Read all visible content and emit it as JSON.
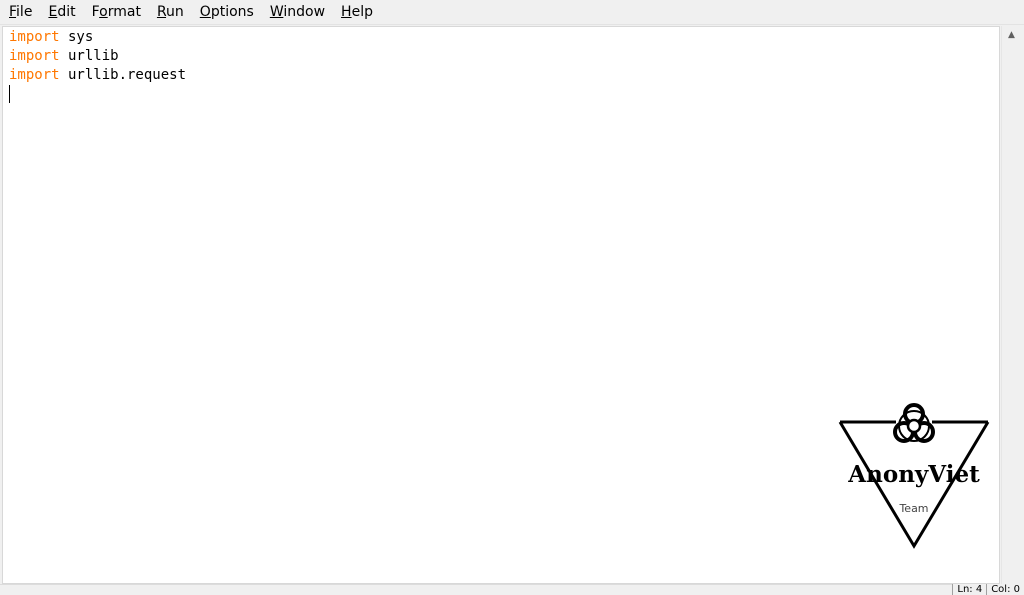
{
  "menu": [
    {
      "label": "File",
      "mnemonic": "F",
      "rest": "ile"
    },
    {
      "label": "Edit",
      "mnemonic": "E",
      "rest": "dit"
    },
    {
      "label": "Format",
      "mnemonic": "o",
      "pre": "F",
      "rest": "rmat"
    },
    {
      "label": "Run",
      "mnemonic": "R",
      "rest": "un"
    },
    {
      "label": "Options",
      "mnemonic": "O",
      "rest": "ptions"
    },
    {
      "label": "Window",
      "mnemonic": "W",
      "rest": "indow"
    },
    {
      "label": "Help",
      "mnemonic": "H",
      "rest": "elp"
    }
  ],
  "editor": {
    "lines": [
      {
        "keyword": "import",
        "text": " sys"
      },
      {
        "keyword": "import",
        "text": " urllib"
      },
      {
        "keyword": "import",
        "text": " urllib.request"
      }
    ],
    "keyword_color": "#ff7700"
  },
  "statusbar": {
    "line": "Ln: 4",
    "col": "Col: 0"
  },
  "watermark": {
    "brand": "AnonyViet",
    "subtitle": "Team",
    "icon": "biohazard-icon"
  }
}
